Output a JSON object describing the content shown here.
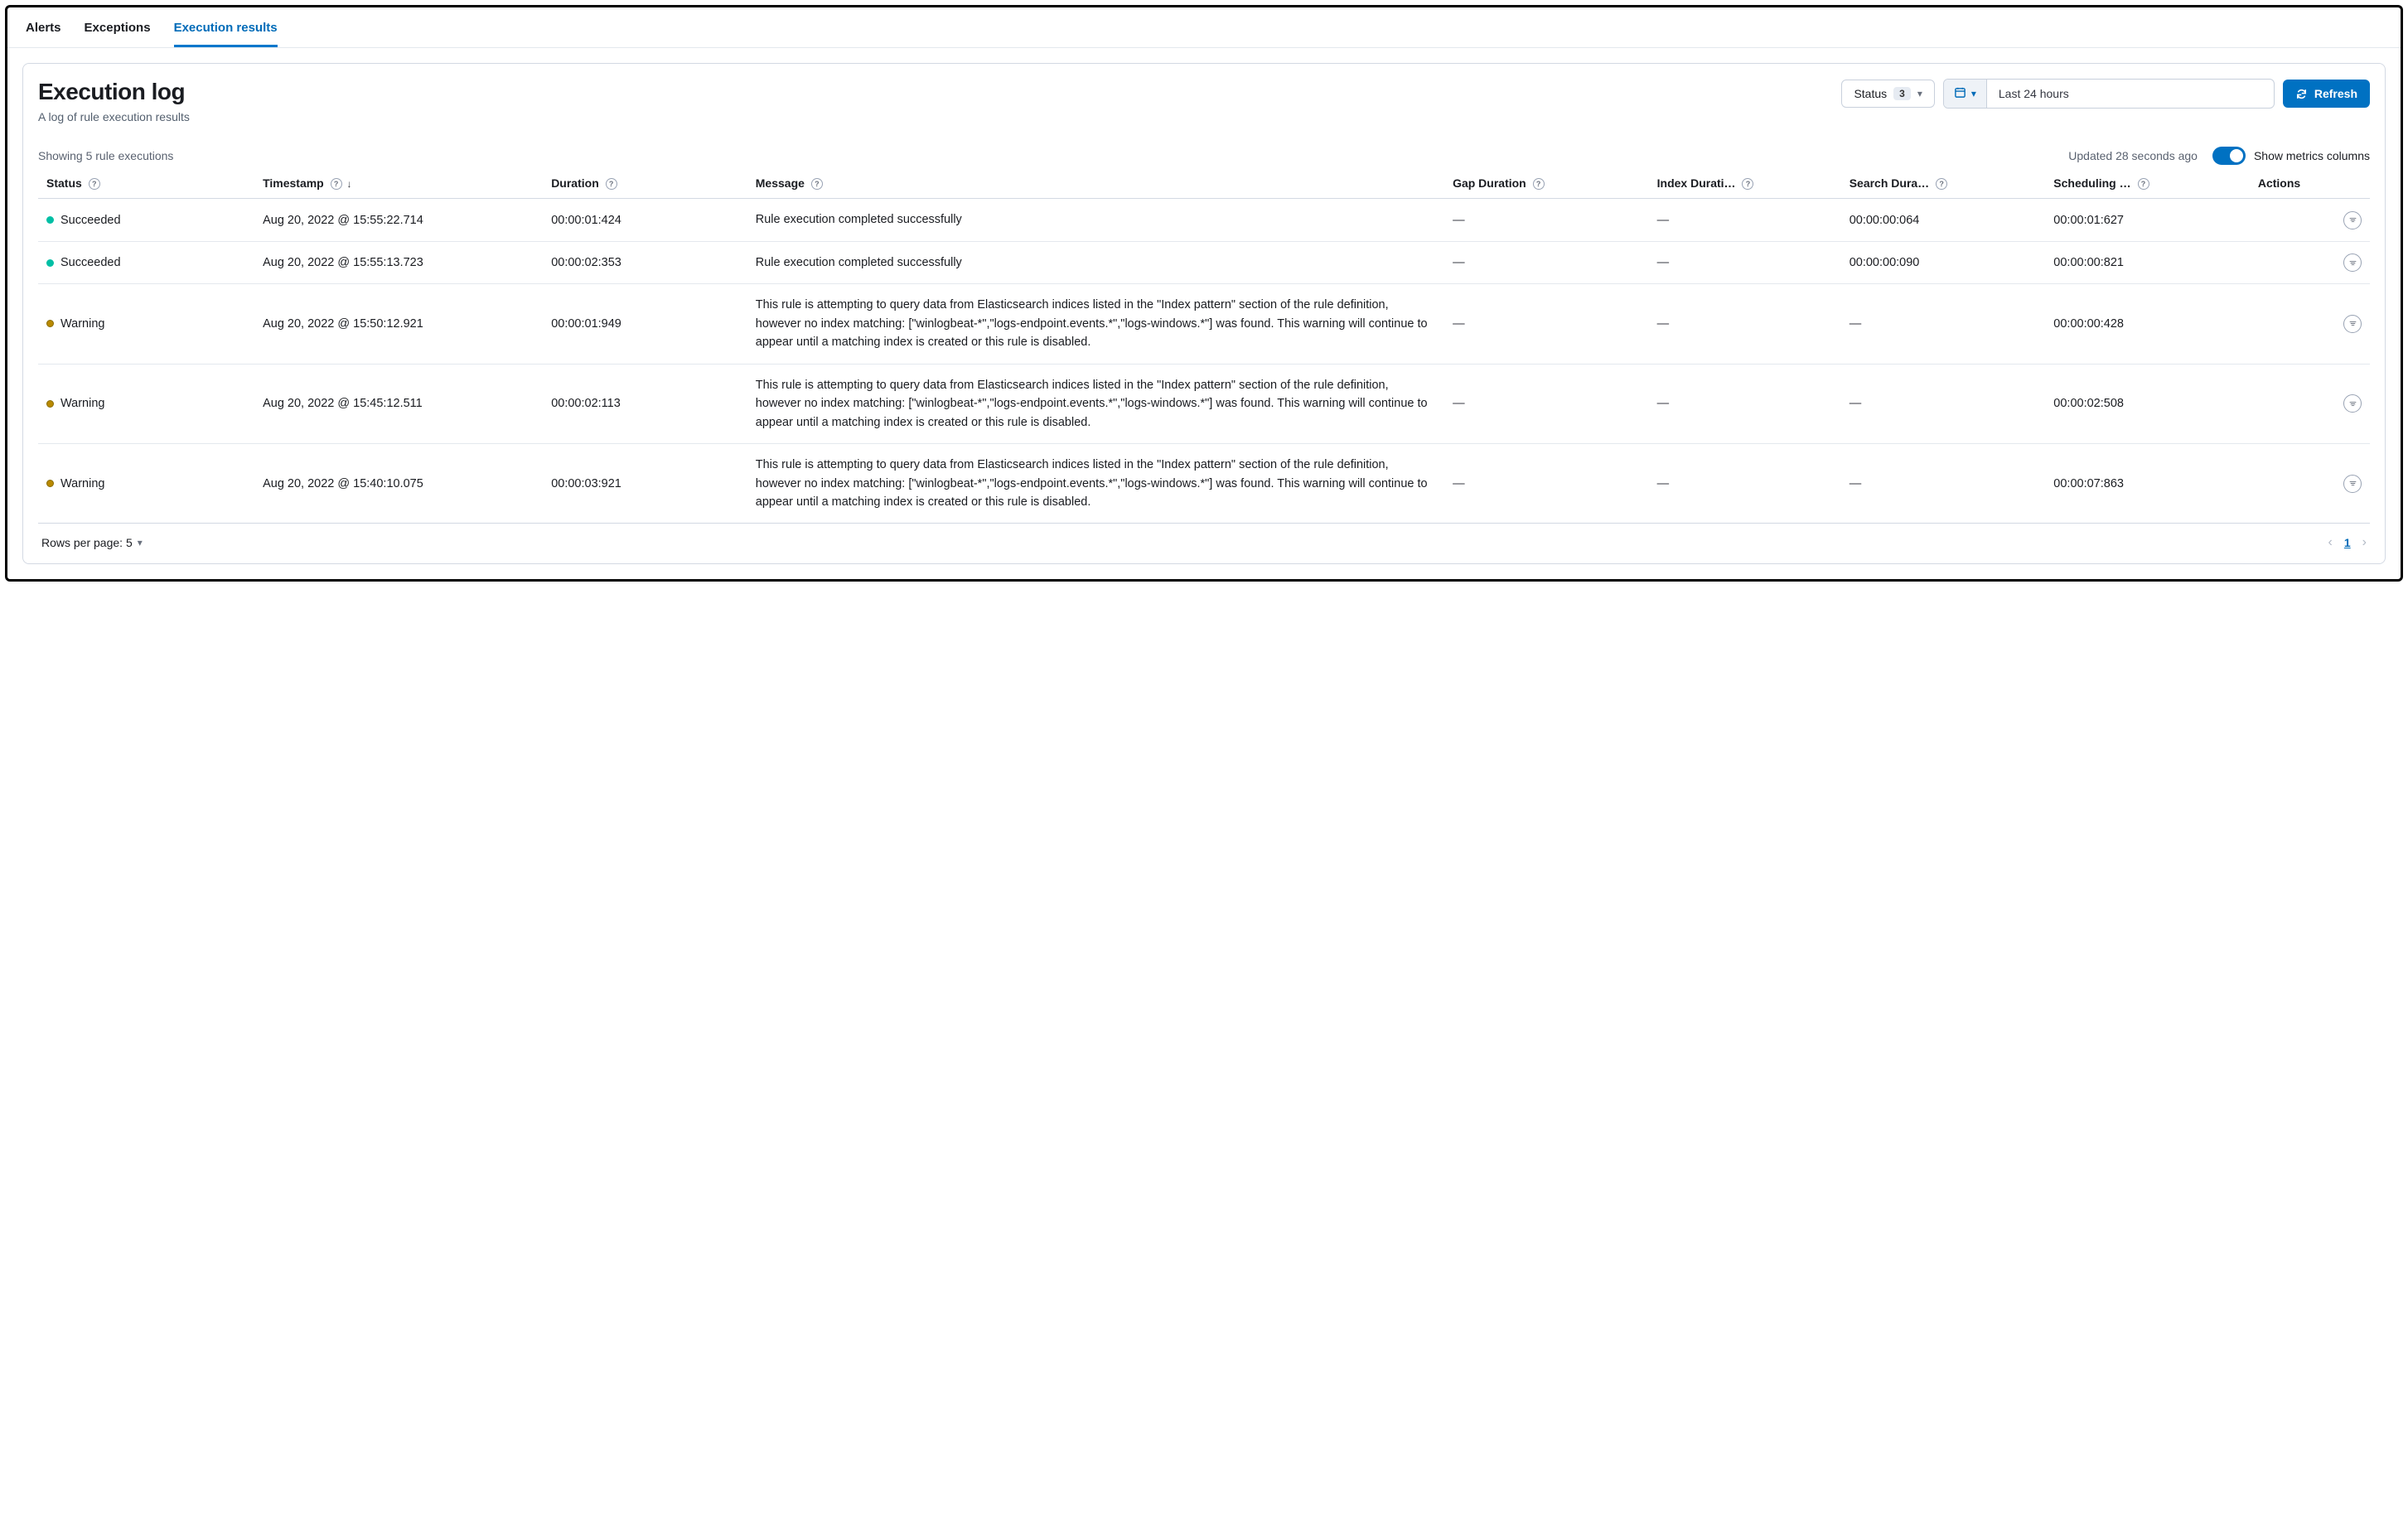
{
  "tabs": {
    "alerts": "Alerts",
    "exceptions": "Exceptions",
    "exec": "Execution results"
  },
  "header": {
    "title": "Execution log",
    "subtitle": "A log of rule execution results"
  },
  "controls": {
    "status_label": "Status",
    "status_count": "3",
    "date_range": "Last 24 hours",
    "refresh": "Refresh"
  },
  "meta": {
    "showing": "Showing 5 rule executions",
    "updated": "Updated 28 seconds ago",
    "toggle_label": "Show metrics columns"
  },
  "columns": {
    "status": "Status",
    "timestamp": "Timestamp",
    "duration": "Duration",
    "message": "Message",
    "gap": "Gap Duration",
    "index": "Index Durati…",
    "search": "Search Dura…",
    "scheduling": "Scheduling …",
    "actions": "Actions"
  },
  "rows": [
    {
      "status": "Succeeded",
      "status_kind": "succ",
      "timestamp": "Aug 20, 2022 @ 15:55:22.714",
      "duration": "00:00:01:424",
      "message": "Rule execution completed successfully",
      "gap": "—",
      "index": "—",
      "search": "00:00:00:064",
      "scheduling": "00:00:01:627"
    },
    {
      "status": "Succeeded",
      "status_kind": "succ",
      "timestamp": "Aug 20, 2022 @ 15:55:13.723",
      "duration": "00:00:02:353",
      "message": "Rule execution completed successfully",
      "gap": "—",
      "index": "—",
      "search": "00:00:00:090",
      "scheduling": "00:00:00:821"
    },
    {
      "status": "Warning",
      "status_kind": "warn",
      "timestamp": "Aug 20, 2022 @ 15:50:12.921",
      "duration": "00:00:01:949",
      "message": "This rule is attempting to query data from Elasticsearch indices listed in the \"Index pattern\" section of the rule definition, however no index matching: [\"winlogbeat-*\",\"logs-endpoint.events.*\",\"logs-windows.*\"] was found. This warning will continue to appear until a matching index is created or this rule is disabled.",
      "gap": "—",
      "index": "—",
      "search": "—",
      "scheduling": "00:00:00:428"
    },
    {
      "status": "Warning",
      "status_kind": "warn",
      "timestamp": "Aug 20, 2022 @ 15:45:12.511",
      "duration": "00:00:02:113",
      "message": "This rule is attempting to query data from Elasticsearch indices listed in the \"Index pattern\" section of the rule definition, however no index matching: [\"winlogbeat-*\",\"logs-endpoint.events.*\",\"logs-windows.*\"] was found. This warning will continue to appear until a matching index is created or this rule is disabled.",
      "gap": "—",
      "index": "—",
      "search": "—",
      "scheduling": "00:00:02:508"
    },
    {
      "status": "Warning",
      "status_kind": "warn",
      "timestamp": "Aug 20, 2022 @ 15:40:10.075",
      "duration": "00:00:03:921",
      "message": "This rule is attempting to query data from Elasticsearch indices listed in the \"Index pattern\" section of the rule definition, however no index matching: [\"winlogbeat-*\",\"logs-endpoint.events.*\",\"logs-windows.*\"] was found. This warning will continue to appear until a matching index is created or this rule is disabled.",
      "gap": "—",
      "index": "—",
      "search": "—",
      "scheduling": "00:00:07:863"
    }
  ],
  "footer": {
    "rows_per_page": "Rows per page: 5",
    "page": "1"
  }
}
